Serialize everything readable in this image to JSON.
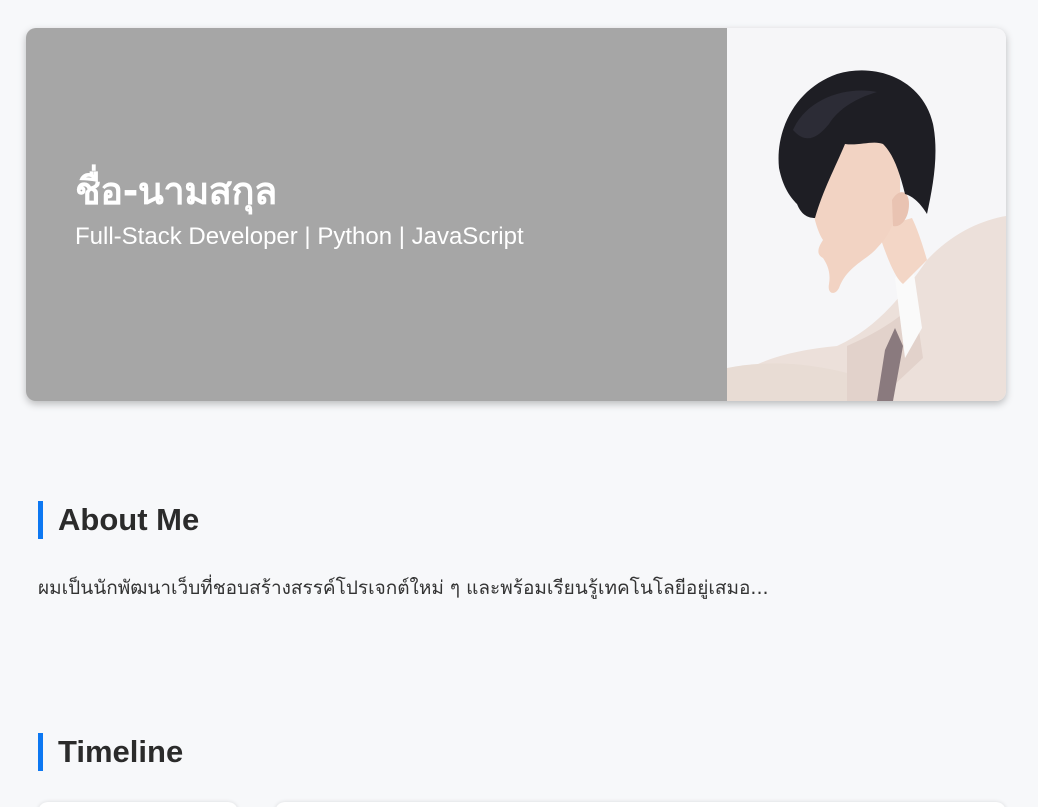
{
  "hero": {
    "name": "ชื่อ-นามสกุล",
    "role": "Full-Stack Developer | Python | JavaScript",
    "background_color": "#a6a6a6",
    "photo_icon": "profile-photo"
  },
  "about": {
    "title": "About Me",
    "text": "ผมเป็นนักพัฒนาเว็บที่ชอบสร้างสรรค์โปรเจกต์ใหม่ ๆ และพร้อมเรียนรู้เทคโนโลยีอยู่เสมอ..."
  },
  "timeline": {
    "title": "Timeline"
  },
  "colors": {
    "accent": "#0d78f2",
    "page_background": "#f7f8fa",
    "heading_text": "#2b2b2b"
  }
}
